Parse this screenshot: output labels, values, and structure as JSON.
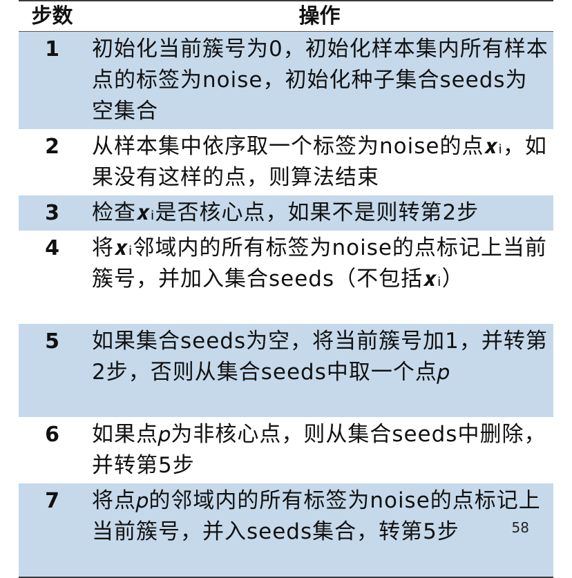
{
  "table": {
    "headers": {
      "step": "步数",
      "operation": "操作"
    },
    "rows": [
      {
        "step": "1",
        "text": "初始化当前簇号为0，初始化样本集内所有样本点的标签为noise，初始化种子集合seeds为空集合"
      },
      {
        "step": "2",
        "text": "从样本集中依序取一个标签为noise的点𝒙ᵢ，如果没有这样的点，则算法结束"
      },
      {
        "step": "3",
        "text": "检查𝒙ᵢ是否核心点，如果不是则转第2步"
      },
      {
        "step": "4",
        "text": "将𝒙ᵢ邻域内的所有标签为noise的点标记上当前簇号，并加入集合seeds（不包括𝒙ᵢ）"
      },
      {
        "step": "5",
        "text": "如果集合seeds为空，将当前簇号加1，并转第2步，否则从集合seeds中取一个点𝑝"
      },
      {
        "step": "6",
        "text": "如果点𝑝为非核心点，则从集合seeds中删除，并转第5步"
      },
      {
        "step": "7",
        "text": "将点𝑝的邻域内的所有标签为noise的点标记上当前簇号，并入seeds集合，转第5步"
      }
    ]
  },
  "page_number": "58"
}
